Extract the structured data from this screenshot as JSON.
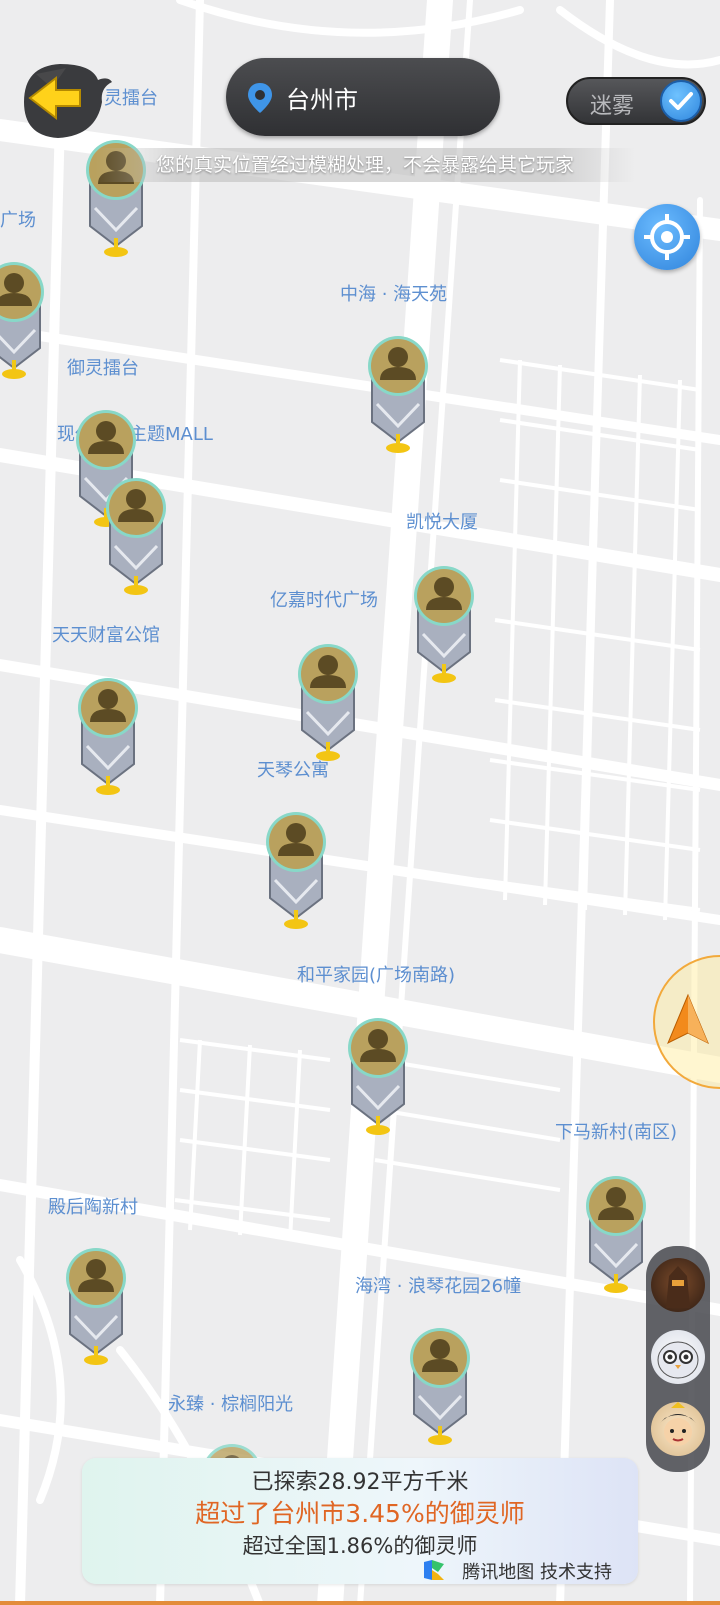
{
  "header": {
    "city": "台州市",
    "fog_label": "迷雾",
    "fog_enabled": true,
    "privacy_note": "您的真实位置经过模糊处理，不会暴露给其它玩家",
    "back_partial_label": "灵擂台"
  },
  "map": {
    "pois": [
      {
        "label": "广场"
      },
      {
        "label": "中海 · 海天苑"
      },
      {
        "label": "御灵擂台"
      },
      {
        "label": "现代天地主题MALL"
      },
      {
        "label": "凯悦大厦"
      },
      {
        "label": "亿嘉时代广场"
      },
      {
        "label": "天天财富公馆"
      },
      {
        "label": "天琴公寓"
      },
      {
        "label": "和平家园(广场南路)"
      },
      {
        "label": "下马新村(南区)"
      },
      {
        "label": "殿后陶新村"
      },
      {
        "label": "海湾 · 浪琴花园26幢"
      },
      {
        "label": "永臻 · 棕榈阳光"
      }
    ],
    "player_marker_count": 14
  },
  "stats": {
    "explored": "已探索28.92平方千米",
    "city_rank": "超过了台州市3.45%的御灵师",
    "national_rank": "超过全国1.86%的御灵师",
    "credit": "腾讯地图 技术支持"
  },
  "icons": {
    "back": "back-arrow-icon",
    "pin": "location-pin-icon",
    "check": "check-icon",
    "locate": "locate-target-icon",
    "nav": "navigation-arrow-icon",
    "marker": "player-marker-icon",
    "tencent_map": "tencent-map-logo-icon"
  },
  "colors": {
    "poi_text": "#5d8fd0",
    "marker_gold": "#b79d5c",
    "accent_orange": "#e06624",
    "toggle_blue": "#2f86dd"
  }
}
